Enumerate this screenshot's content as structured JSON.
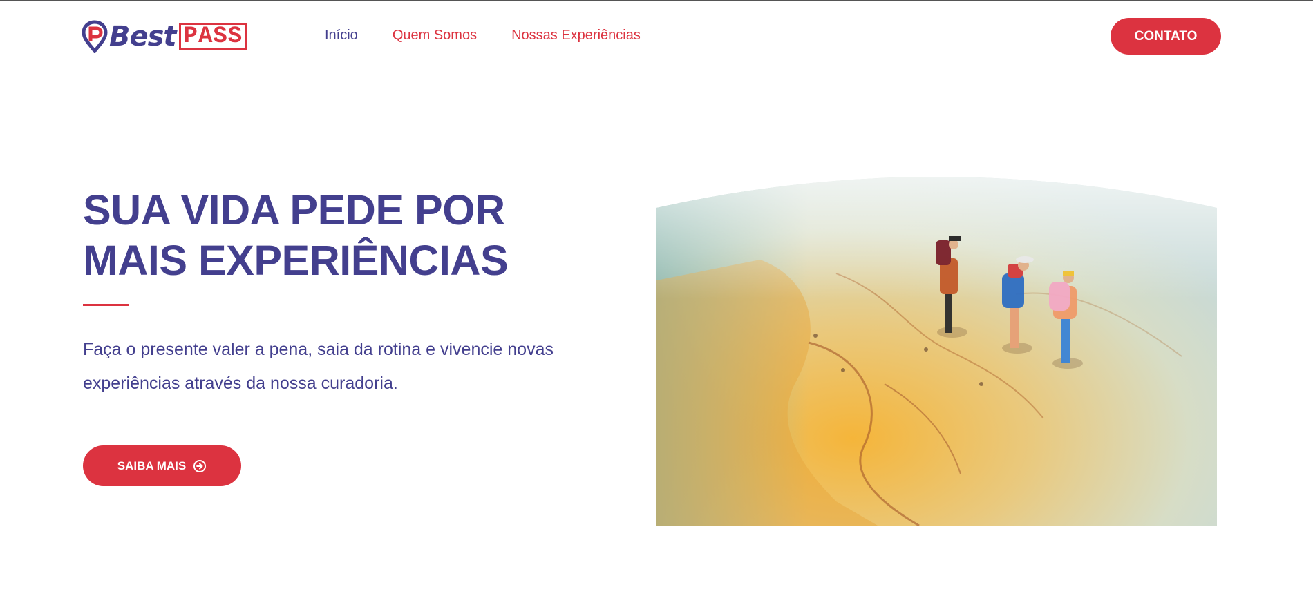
{
  "colors": {
    "brand_blue": "#433f8e",
    "brand_red": "#dc3340",
    "background": "#ffffff"
  },
  "logo": {
    "best": "Best",
    "pass": "PASS"
  },
  "nav": {
    "items": [
      {
        "label": "Início",
        "icon": null
      },
      {
        "label": "Quem Somos",
        "icon": null
      },
      {
        "label": "Nossas Experiências",
        "icon": null
      }
    ]
  },
  "header": {
    "contact_label": "CONTATO"
  },
  "hero": {
    "title": "SUA VIDA PEDE POR MAIS EXPERIÊNCIAS",
    "text": "Faça o presente valer a pena, saia da rotina e vivencie novas experiências através da nossa curadoria.",
    "cta_label": "SAIBA MAIS",
    "cta_icon": "arrow-circle-right-icon",
    "image_icon": "travel-map-photo"
  }
}
